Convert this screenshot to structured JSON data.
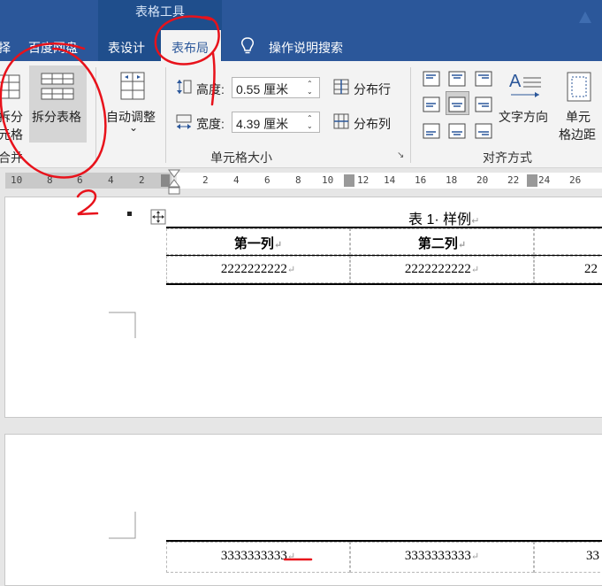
{
  "ribbon_tabs": {
    "contextual_group": "表格工具",
    "partial_left": "择",
    "baidu": "百度网盘",
    "design": "表设计",
    "layout": "表布局",
    "search": "操作说明搜索"
  },
  "ribbon": {
    "split_cells": [
      "拆分",
      "元格"
    ],
    "split_table": "拆分表格",
    "merge_group": "合并",
    "autofit": "自动调整",
    "autofit_arrow": "⌄",
    "height_label": "高度:",
    "height_value": "0.55 厘米",
    "width_label": "宽度:",
    "width_value": "4.39 厘米",
    "distribute_rows": "分布行",
    "distribute_cols": "分布列",
    "cell_size_group": "单元格大小",
    "text_direction": "文字方向",
    "cell_margins": [
      "单元",
      "格边距"
    ],
    "alignment_group": "对齐方式"
  },
  "ruler": {
    "left_ticks": [
      "10",
      "8",
      "6",
      "4",
      "2"
    ],
    "right_ticks": [
      "2",
      "4",
      "6",
      "8",
      "10",
      "12",
      "14",
      "16",
      "18",
      "20",
      "22",
      "24",
      "26"
    ]
  },
  "document": {
    "caption": "表 1· 样例",
    "headers": [
      "第一列",
      "第二列"
    ],
    "row1": [
      "2222222222",
      "2222222222",
      "22"
    ],
    "row2": [
      "3333333333",
      "3333333333",
      "33"
    ],
    "para_mark": "↵"
  },
  "annotation": {
    "step_number": "2"
  },
  "colors": {
    "ribbon_blue": "#2b579a",
    "annotation_red": "#e8121b"
  }
}
